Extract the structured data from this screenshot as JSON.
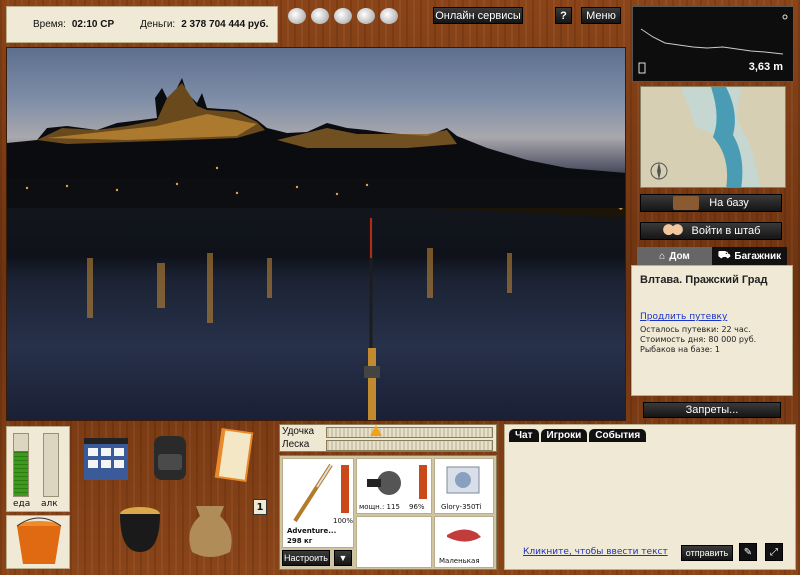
{
  "status": {
    "time_label": "Время:",
    "time_value": "02:10 СР",
    "money_label": "Деньги:",
    "money_value": "2 378 704 444 руб."
  },
  "top": {
    "online_services": "Онлайн сервисы",
    "help": "?",
    "menu": "Меню"
  },
  "depth": {
    "value": "3,63 m"
  },
  "side": {
    "to_base": "На базу",
    "enter_hq": "Войти в штаб",
    "home_tab": "Дом",
    "trunk_tab": "Багажник",
    "bans": "Запреты..."
  },
  "location": {
    "title": "Влтава. Пражский Град",
    "extend_link": "Продлить путевку",
    "remaining": "Осталось путевки: 22 час.",
    "day_cost": "Стоимость дня: 80 000 руб.",
    "anglers": "Рыбаков на базе: 1"
  },
  "meters": {
    "food_label": "еда",
    "alc_label": "алк",
    "food_level": 0.72,
    "alc_level": 0.0
  },
  "inventory": {
    "slot_badge": "1"
  },
  "tackle": {
    "rod_label": "Удочка",
    "line_label": "Леска",
    "rod_name": "Adventure...",
    "rod_weight": "298 кг",
    "rod_percent": "100%",
    "reel_power_label": "мощн.: 115",
    "reel_percent": "96%",
    "line_name": "Glory-350Ti",
    "lure_name": "Маленькая",
    "setup_button": "Настроить",
    "dropdown": "▼"
  },
  "chat": {
    "tabs": [
      "Чат",
      "Игроки",
      "События"
    ],
    "input_link": "Кликните, чтобы ввести текст",
    "send_button": "отправить"
  },
  "colors": {
    "wood": "#7a3a16",
    "panel": "#efe9d6",
    "link": "#1a33c4"
  }
}
